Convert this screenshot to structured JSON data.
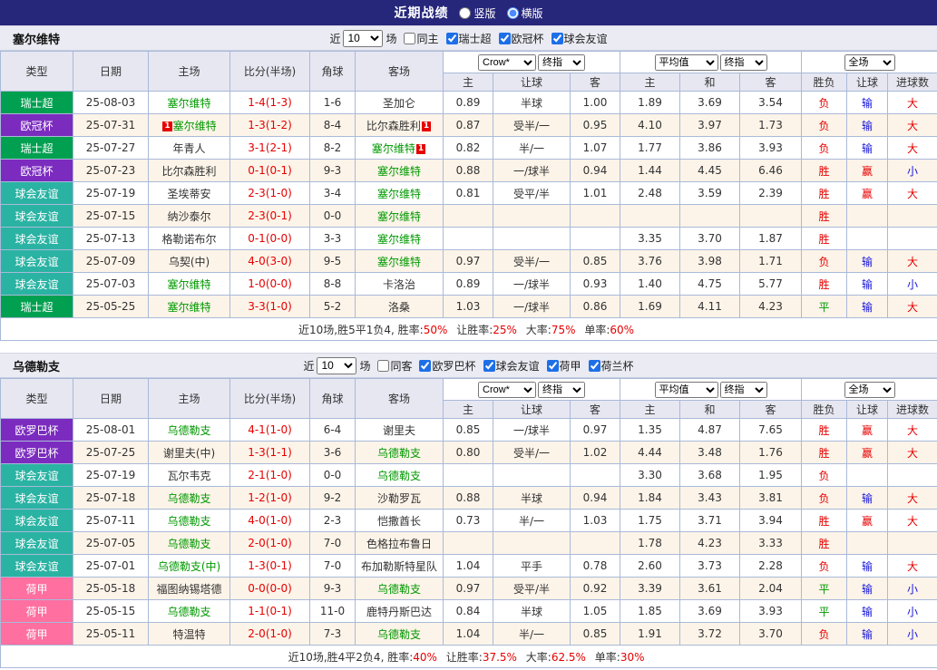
{
  "palette": {
    "topbar_bg": "#26267b",
    "red": "#e60000",
    "blue": "#1515dd",
    "green": "#009900",
    "team_green": "#009900",
    "type_colors": {
      "瑞士超": "#00a050",
      "欧冠杯": "#7b2cbf",
      "球会友谊": "#2ab3a3",
      "欧罗巴杯": "#7b2cbf",
      "荷甲": "#ff6f9f"
    }
  },
  "topbar": {
    "title": "近期战绩",
    "vertical": "竖版",
    "horizontal": "横版",
    "selected": "横版"
  },
  "table_header": {
    "col_type": "类型",
    "col_date": "日期",
    "col_home": "主场",
    "col_score": "比分(半场)",
    "col_corner": "角球",
    "col_away": "客场",
    "odds1_dropdowns": [
      "Crow*",
      "终指"
    ],
    "odds2_dropdowns": [
      "平均值",
      "终指"
    ],
    "result_dropdown": "全场",
    "odds1_cols": [
      "主",
      "让球",
      "客"
    ],
    "odds2_cols": [
      "主",
      "和",
      "客"
    ],
    "result_cols": [
      "胜负",
      "让球",
      "进球数"
    ]
  },
  "sections": [
    {
      "team": "塞尔维特",
      "filters": {
        "near_label": "近",
        "count": "10",
        "games_label": "场",
        "same_label": "同主",
        "same_checked": false,
        "leagues": [
          {
            "label": "瑞士超",
            "checked": true
          },
          {
            "label": "欧冠杯",
            "checked": true
          },
          {
            "label": "球会友谊",
            "checked": true
          }
        ]
      },
      "rows": [
        {
          "type": "瑞士超",
          "date": "25-08-03",
          "home": {
            "name": "塞尔维特",
            "focus": true
          },
          "score": "1-4(1-3)",
          "corner": "1-6",
          "away": {
            "name": "圣加仑",
            "focus": false
          },
          "odds1": [
            "0.89",
            "半球",
            "1.00"
          ],
          "odds2": [
            "1.89",
            "3.69",
            "3.54"
          ],
          "results": [
            {
              "text": "负",
              "color": "red"
            },
            {
              "text": "输",
              "color": "blue"
            },
            {
              "text": "大",
              "color": "red"
            }
          ]
        },
        {
          "type": "欧冠杯",
          "date": "25-07-31",
          "home": {
            "name": "塞尔维特",
            "focus": true,
            "badge": "1",
            "badge_side": "left"
          },
          "score": "1-3(1-2)",
          "corner": "8-4",
          "away": {
            "name": "比尔森胜利",
            "focus": false,
            "badge": "1",
            "badge_side": "right"
          },
          "odds1": [
            "0.87",
            "受半/一",
            "0.95"
          ],
          "odds2": [
            "4.10",
            "3.97",
            "1.73"
          ],
          "results": [
            {
              "text": "负",
              "color": "red"
            },
            {
              "text": "输",
              "color": "blue"
            },
            {
              "text": "大",
              "color": "red"
            }
          ]
        },
        {
          "type": "瑞士超",
          "date": "25-07-27",
          "home": {
            "name": "年青人",
            "focus": false
          },
          "score": "3-1(2-1)",
          "corner": "8-2",
          "away": {
            "name": "塞尔维特",
            "focus": true,
            "badge": "1",
            "badge_side": "right"
          },
          "odds1": [
            "0.82",
            "半/一",
            "1.07"
          ],
          "odds2": [
            "1.77",
            "3.86",
            "3.93"
          ],
          "results": [
            {
              "text": "负",
              "color": "red"
            },
            {
              "text": "输",
              "color": "blue"
            },
            {
              "text": "大",
              "color": "red"
            }
          ]
        },
        {
          "type": "欧冠杯",
          "date": "25-07-23",
          "home": {
            "name": "比尔森胜利",
            "focus": false
          },
          "score": "0-1(0-1)",
          "corner": "9-3",
          "away": {
            "name": "塞尔维特",
            "focus": true
          },
          "odds1": [
            "0.88",
            "一/球半",
            "0.94"
          ],
          "odds2": [
            "1.44",
            "4.45",
            "6.46"
          ],
          "results": [
            {
              "text": "胜",
              "color": "red"
            },
            {
              "text": "赢",
              "color": "red"
            },
            {
              "text": "小",
              "color": "blue"
            }
          ]
        },
        {
          "type": "球会友谊",
          "date": "25-07-19",
          "home": {
            "name": "圣埃蒂安",
            "focus": false
          },
          "score": "2-3(1-0)",
          "corner": "3-4",
          "away": {
            "name": "塞尔维特",
            "focus": true
          },
          "odds1": [
            "0.81",
            "受平/半",
            "1.01"
          ],
          "odds2": [
            "2.48",
            "3.59",
            "2.39"
          ],
          "results": [
            {
              "text": "胜",
              "color": "red"
            },
            {
              "text": "赢",
              "color": "red"
            },
            {
              "text": "大",
              "color": "red"
            }
          ]
        },
        {
          "type": "球会友谊",
          "date": "25-07-15",
          "home": {
            "name": "纳沙泰尔",
            "focus": false
          },
          "score": "2-3(0-1)",
          "corner": "0-0",
          "away": {
            "name": "塞尔维特",
            "focus": true
          },
          "odds1": [
            "",
            "",
            ""
          ],
          "odds2": [
            "",
            "",
            ""
          ],
          "results": [
            {
              "text": "胜",
              "color": "red"
            },
            {
              "text": "",
              "color": ""
            },
            {
              "text": "",
              "color": ""
            }
          ]
        },
        {
          "type": "球会友谊",
          "date": "25-07-13",
          "home": {
            "name": "格勒诺布尔",
            "focus": false
          },
          "score": "0-1(0-0)",
          "corner": "3-3",
          "away": {
            "name": "塞尔维特",
            "focus": true
          },
          "odds1": [
            "",
            "",
            ""
          ],
          "odds2": [
            "3.35",
            "3.70",
            "1.87"
          ],
          "results": [
            {
              "text": "胜",
              "color": "red"
            },
            {
              "text": "",
              "color": ""
            },
            {
              "text": "",
              "color": ""
            }
          ]
        },
        {
          "type": "球会友谊",
          "date": "25-07-09",
          "home": {
            "name": "乌契(中)",
            "focus": false
          },
          "score": "4-0(3-0)",
          "corner": "9-5",
          "away": {
            "name": "塞尔维特",
            "focus": true
          },
          "odds1": [
            "0.97",
            "受半/一",
            "0.85"
          ],
          "odds2": [
            "3.76",
            "3.98",
            "1.71"
          ],
          "results": [
            {
              "text": "负",
              "color": "red"
            },
            {
              "text": "输",
              "color": "blue"
            },
            {
              "text": "大",
              "color": "red"
            }
          ]
        },
        {
          "type": "球会友谊",
          "date": "25-07-03",
          "home": {
            "name": "塞尔维特",
            "focus": true
          },
          "score": "1-0(0-0)",
          "corner": "8-8",
          "away": {
            "name": "卡洛治",
            "focus": false
          },
          "odds1": [
            "0.89",
            "一/球半",
            "0.93"
          ],
          "odds2": [
            "1.40",
            "4.75",
            "5.77"
          ],
          "results": [
            {
              "text": "胜",
              "color": "red"
            },
            {
              "text": "输",
              "color": "blue"
            },
            {
              "text": "小",
              "color": "blue"
            }
          ]
        },
        {
          "type": "瑞士超",
          "date": "25-05-25",
          "home": {
            "name": "塞尔维特",
            "focus": true
          },
          "score": "3-3(1-0)",
          "corner": "5-2",
          "away": {
            "name": "洛桑",
            "focus": false
          },
          "odds1": [
            "1.03",
            "一/球半",
            "0.86"
          ],
          "odds2": [
            "1.69",
            "4.11",
            "4.23"
          ],
          "results": [
            {
              "text": "平",
              "color": "green"
            },
            {
              "text": "输",
              "color": "blue"
            },
            {
              "text": "大",
              "color": "red"
            }
          ]
        }
      ],
      "summary": {
        "prefix": "近10场,胜5平1负4,",
        "stats": [
          {
            "label": "胜率:",
            "value": "50%"
          },
          {
            "label": "让胜率:",
            "value": "25%"
          },
          {
            "label": "大率:",
            "value": "75%"
          },
          {
            "label": "单率:",
            "value": "60%"
          }
        ]
      }
    },
    {
      "team": "乌德勒支",
      "filters": {
        "near_label": "近",
        "count": "10",
        "games_label": "场",
        "same_label": "同客",
        "same_checked": false,
        "leagues": [
          {
            "label": "欧罗巴杯",
            "checked": true
          },
          {
            "label": "球会友谊",
            "checked": true
          },
          {
            "label": "荷甲",
            "checked": true
          },
          {
            "label": "荷兰杯",
            "checked": true
          }
        ]
      },
      "rows": [
        {
          "type": "欧罗巴杯",
          "date": "25-08-01",
          "home": {
            "name": "乌德勒支",
            "focus": true
          },
          "score": "4-1(1-0)",
          "corner": "6-4",
          "away": {
            "name": "谢里夫",
            "focus": false
          },
          "odds1": [
            "0.85",
            "一/球半",
            "0.97"
          ],
          "odds2": [
            "1.35",
            "4.87",
            "7.65"
          ],
          "results": [
            {
              "text": "胜",
              "color": "red"
            },
            {
              "text": "赢",
              "color": "red"
            },
            {
              "text": "大",
              "color": "red"
            }
          ]
        },
        {
          "type": "欧罗巴杯",
          "date": "25-07-25",
          "home": {
            "name": "谢里夫(中)",
            "focus": false
          },
          "score": "1-3(1-1)",
          "corner": "3-6",
          "away": {
            "name": "乌德勒支",
            "focus": true
          },
          "odds1": [
            "0.80",
            "受半/一",
            "1.02"
          ],
          "odds2": [
            "4.44",
            "3.48",
            "1.76"
          ],
          "results": [
            {
              "text": "胜",
              "color": "red"
            },
            {
              "text": "赢",
              "color": "red"
            },
            {
              "text": "大",
              "color": "red"
            }
          ]
        },
        {
          "type": "球会友谊",
          "date": "25-07-19",
          "home": {
            "name": "瓦尔韦克",
            "focus": false
          },
          "score": "2-1(1-0)",
          "corner": "0-0",
          "away": {
            "name": "乌德勒支",
            "focus": true
          },
          "odds1": [
            "",
            "",
            ""
          ],
          "odds2": [
            "3.30",
            "3.68",
            "1.95"
          ],
          "results": [
            {
              "text": "负",
              "color": "red"
            },
            {
              "text": "",
              "color": ""
            },
            {
              "text": "",
              "color": ""
            }
          ]
        },
        {
          "type": "球会友谊",
          "date": "25-07-18",
          "home": {
            "name": "乌德勒支",
            "focus": true
          },
          "score": "1-2(1-0)",
          "corner": "9-2",
          "away": {
            "name": "沙勒罗瓦",
            "focus": false
          },
          "odds1": [
            "0.88",
            "半球",
            "0.94"
          ],
          "odds2": [
            "1.84",
            "3.43",
            "3.81"
          ],
          "results": [
            {
              "text": "负",
              "color": "red"
            },
            {
              "text": "输",
              "color": "blue"
            },
            {
              "text": "大",
              "color": "red"
            }
          ]
        },
        {
          "type": "球会友谊",
          "date": "25-07-11",
          "home": {
            "name": "乌德勒支",
            "focus": true
          },
          "score": "4-0(1-0)",
          "corner": "2-3",
          "away": {
            "name": "恺撒酋长",
            "focus": false
          },
          "odds1": [
            "0.73",
            "半/一",
            "1.03"
          ],
          "odds2": [
            "1.75",
            "3.71",
            "3.94"
          ],
          "results": [
            {
              "text": "胜",
              "color": "red"
            },
            {
              "text": "赢",
              "color": "red"
            },
            {
              "text": "大",
              "color": "red"
            }
          ]
        },
        {
          "type": "球会友谊",
          "date": "25-07-05",
          "home": {
            "name": "乌德勒支",
            "focus": true
          },
          "score": "2-0(1-0)",
          "corner": "7-0",
          "away": {
            "name": "色格拉布鲁日",
            "focus": false
          },
          "odds1": [
            "",
            "",
            ""
          ],
          "odds2": [
            "1.78",
            "4.23",
            "3.33"
          ],
          "results": [
            {
              "text": "胜",
              "color": "red"
            },
            {
              "text": "",
              "color": ""
            },
            {
              "text": "",
              "color": ""
            }
          ]
        },
        {
          "type": "球会友谊",
          "date": "25-07-01",
          "home": {
            "name": "乌德勒支(中)",
            "focus": true
          },
          "score": "1-3(0-1)",
          "corner": "7-0",
          "away": {
            "name": "布加勒斯特星队",
            "focus": false
          },
          "odds1": [
            "1.04",
            "平手",
            "0.78"
          ],
          "odds2": [
            "2.60",
            "3.73",
            "2.28"
          ],
          "results": [
            {
              "text": "负",
              "color": "red"
            },
            {
              "text": "输",
              "color": "blue"
            },
            {
              "text": "大",
              "color": "red"
            }
          ]
        },
        {
          "type": "荷甲",
          "date": "25-05-18",
          "home": {
            "name": "福图纳锡塔德",
            "focus": false
          },
          "score": "0-0(0-0)",
          "corner": "9-3",
          "away": {
            "name": "乌德勒支",
            "focus": true
          },
          "odds1": [
            "0.97",
            "受平/半",
            "0.92"
          ],
          "odds2": [
            "3.39",
            "3.61",
            "2.04"
          ],
          "results": [
            {
              "text": "平",
              "color": "green"
            },
            {
              "text": "输",
              "color": "blue"
            },
            {
              "text": "小",
              "color": "blue"
            }
          ]
        },
        {
          "type": "荷甲",
          "date": "25-05-15",
          "home": {
            "name": "乌德勒支",
            "focus": true
          },
          "score": "1-1(0-1)",
          "corner": "11-0",
          "away": {
            "name": "鹿特丹斯巴达",
            "focus": false
          },
          "odds1": [
            "0.84",
            "半球",
            "1.05"
          ],
          "odds2": [
            "1.85",
            "3.69",
            "3.93"
          ],
          "results": [
            {
              "text": "平",
              "color": "green"
            },
            {
              "text": "输",
              "color": "blue"
            },
            {
              "text": "小",
              "color": "blue"
            }
          ]
        },
        {
          "type": "荷甲",
          "date": "25-05-11",
          "home": {
            "name": "特温特",
            "focus": false
          },
          "score": "2-0(1-0)",
          "corner": "7-3",
          "away": {
            "name": "乌德勒支",
            "focus": true
          },
          "odds1": [
            "1.04",
            "半/一",
            "0.85"
          ],
          "odds2": [
            "1.91",
            "3.72",
            "3.70"
          ],
          "results": [
            {
              "text": "负",
              "color": "red"
            },
            {
              "text": "输",
              "color": "blue"
            },
            {
              "text": "小",
              "color": "blue"
            }
          ]
        }
      ],
      "summary": {
        "prefix": "近10场,胜4平2负4,",
        "stats": [
          {
            "label": "胜率:",
            "value": "40%"
          },
          {
            "label": "让胜率:",
            "value": "37.5%"
          },
          {
            "label": "大率:",
            "value": "62.5%"
          },
          {
            "label": "单率:",
            "value": "30%"
          }
        ]
      }
    }
  ]
}
